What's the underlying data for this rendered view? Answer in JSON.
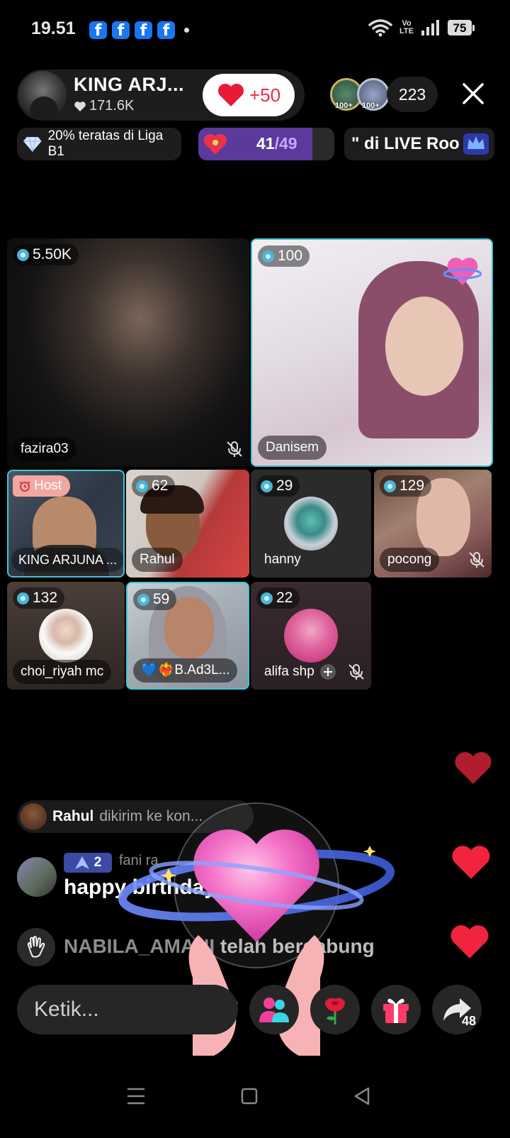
{
  "status_bar": {
    "time": "19.51",
    "notification_icons": [
      "facebook-icon",
      "facebook-icon",
      "facebook-icon",
      "facebook-icon"
    ],
    "network": "Vo LTE",
    "battery": "75"
  },
  "host": {
    "name": "KING ARJ...",
    "likes": "171.6K",
    "follow_label": "+50"
  },
  "viewers": {
    "avatar_badges": [
      "100+",
      "100+"
    ],
    "count": "223"
  },
  "badges": {
    "rank_text": "20% teratas di Liga B1",
    "progress_current": "41",
    "progress_total": "/49",
    "progress_fraction": 0.84,
    "marquee_text": "\" di LIVE Roo"
  },
  "guests": [
    {
      "name": "fazira03",
      "score": "5.50K",
      "muted": true
    },
    {
      "name": "Danisem",
      "score": "100",
      "muted": false
    },
    {
      "name": "KING ARJUNA ...",
      "host_label": "Host"
    },
    {
      "name": "Rahul",
      "score": "62"
    },
    {
      "name": "hanny",
      "score": "29"
    },
    {
      "name": "pocong",
      "score": "129",
      "muted": true
    },
    {
      "name": "choi_riyah mc",
      "score": "132"
    },
    {
      "name": "💙❤️‍🔥B.Ad3L...",
      "score": "59"
    },
    {
      "name": "alifa shp",
      "score": "22",
      "muted": true
    }
  ],
  "chat": {
    "gift_notice_user": "Rahul",
    "gift_notice_text": "dikirim ke kon...",
    "message_level": "2",
    "message_user": "fani ra",
    "message_text": "happy birthday",
    "join_user": "NABILA_AMANI",
    "join_text": "telah bergabung"
  },
  "bottom": {
    "input_placeholder": "Ketik...",
    "share_count": "48"
  },
  "colors": {
    "accent_red": "#ef2b4c",
    "tile_highlight": "#3ec7d6",
    "progress_purple": "#5a3a9a",
    "host_label": "#f1a8a2"
  }
}
